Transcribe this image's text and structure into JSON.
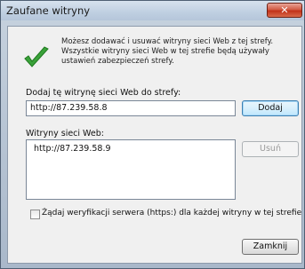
{
  "window": {
    "title": "Zaufane witryny",
    "close_label": "✕"
  },
  "info": {
    "icon": "green-checkmark-icon",
    "text": "Możesz dodawać i usuwać witryny sieci Web z tej strefy.\nWszystkie witryny sieci Web w tej strefie będą używały\nustawień zabezpieczeń strefy."
  },
  "add_site": {
    "label": "Dodaj tę witrynę sieci Web do strefy:",
    "value": "http://87.239.58.8",
    "button_label": "Dodaj"
  },
  "sites": {
    "label": "Witryny sieci Web:",
    "items": [
      "http://87.239.58.9"
    ],
    "remove_label": "Usuń"
  },
  "verify": {
    "label": "Żądaj weryfikacji serwera (https:) dla każdej witryny w tej strefie",
    "checked": false
  },
  "footer": {
    "close_label": "Zamknij"
  },
  "colors": {
    "accent": "#2e9c2e",
    "close_red": "#c1311a"
  }
}
